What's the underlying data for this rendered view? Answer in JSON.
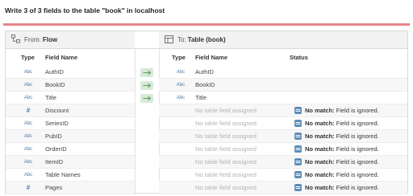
{
  "dialog": {
    "title": "Write 3 of 3 fields to the table \"book\" in localhost"
  },
  "source": {
    "lead": "From:",
    "name": "Flow",
    "icon": "flow-icon",
    "columns": {
      "type": "Type",
      "field": "Field Name"
    },
    "rows": [
      {
        "type": "Abc",
        "name": "AuthID"
      },
      {
        "type": "Abc",
        "name": "BookID"
      },
      {
        "type": "Abc",
        "name": "Title"
      },
      {
        "type": "#",
        "name": "Discount"
      },
      {
        "type": "Abc",
        "name": "SeriesID"
      },
      {
        "type": "Abc",
        "name": "PubID"
      },
      {
        "type": "Abc",
        "name": "OrderID"
      },
      {
        "type": "Abc",
        "name": "ItemID"
      },
      {
        "type": "Abc",
        "name": "Table Names"
      },
      {
        "type": "#",
        "name": "Pages"
      }
    ]
  },
  "mapping": {
    "mapped_rows": 3,
    "arrow_icon": "arrow-right-icon",
    "arrow_color": "#5aa05e"
  },
  "target": {
    "lead": "To:",
    "name": "Table (book)",
    "icon": "table-icon",
    "columns": {
      "type": "Type",
      "field": "Field Name",
      "status": "Status"
    },
    "rows": [
      {
        "type": "Abc",
        "name": "AuthID",
        "status_strong": "",
        "status_rest": ""
      },
      {
        "type": "Abc",
        "name": "BookID",
        "status_strong": "",
        "status_rest": ""
      },
      {
        "type": "Abc",
        "name": "Title",
        "status_strong": "",
        "status_rest": ""
      },
      {
        "type": "",
        "name": "No table field assigned",
        "status_strong": "No match:",
        "status_rest": "Field is ignored."
      },
      {
        "type": "",
        "name": "No table field assigned",
        "status_strong": "No match:",
        "status_rest": "Field is ignored."
      },
      {
        "type": "",
        "name": "No table field assigned",
        "status_strong": "No match:",
        "status_rest": "Field is ignored."
      },
      {
        "type": "",
        "name": "No table field assigned",
        "status_strong": "No match:",
        "status_rest": "Field is ignored."
      },
      {
        "type": "",
        "name": "No table field assigned",
        "status_strong": "No match:",
        "status_rest": "Field is ignored."
      },
      {
        "type": "",
        "name": "No table field assigned",
        "status_strong": "No match:",
        "status_rest": "Field is ignored."
      },
      {
        "type": "",
        "name": "No table field assigned",
        "status_strong": "No match:",
        "status_rest": "Field is ignored."
      }
    ]
  },
  "colors": {
    "accent_rule": "#e8868a",
    "type_icon": "#4e79a7",
    "status_icon": "#5c8cb7"
  }
}
